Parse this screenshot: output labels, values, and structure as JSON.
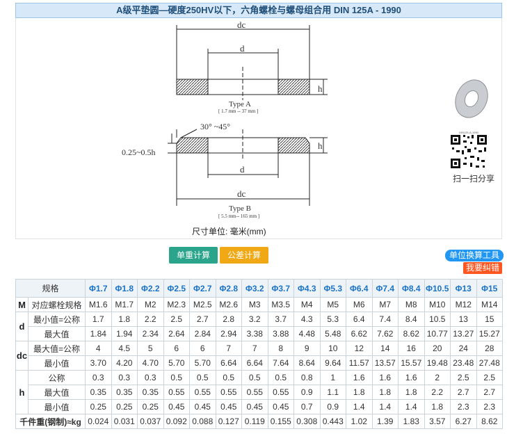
{
  "title": "A级平垫圆—硬度250HV以下，六角螺栓与螺母组合用 DIN 125A - 1990",
  "drawing": {
    "dim_dc": "dc",
    "dim_d": "d",
    "dim_h": "h",
    "type_a": "Type A",
    "type_a_range": "[ 1.7 mm -- 37 mm ]",
    "type_b": "Type B",
    "type_b_range": "[ 5.5 mm-- 165 mm ]",
    "angle": "30° ~45°",
    "chamfer": "0.25~0.5h",
    "unit": "尺寸单位: 毫米(mm)"
  },
  "share": {
    "qr_top": "DIN125-A-1990",
    "caption": "扫一扫分享"
  },
  "buttons": {
    "weight": "单重计算",
    "tolerance": "公差计算",
    "unit_tool": "单位换算工具",
    "report": "我要纠错"
  },
  "table": {
    "spec_label": "规格",
    "sizes": [
      "Φ1.7",
      "Φ1.8",
      "Φ2.2",
      "Φ2.5",
      "Φ2.7",
      "Φ2.8",
      "Φ3.2",
      "Φ3.7",
      "Φ4.3",
      "Φ5.3",
      "Φ6.4",
      "Φ7.4",
      "Φ8.4",
      "Φ10.5",
      "Φ13",
      "Φ15"
    ],
    "rows": [
      {
        "sym": "M",
        "label": "对应螺栓规格",
        "values": [
          "M1.6",
          "M1.7",
          "M2",
          "M2.3",
          "M2.5",
          "M2.6",
          "M3",
          "M3.5",
          "M4",
          "M5",
          "M6",
          "M7",
          "M8",
          "M10",
          "M12",
          "M14"
        ]
      },
      {
        "sym": "d",
        "label": "最小值=公称",
        "values": [
          "1.7",
          "1.8",
          "2.2",
          "2.5",
          "2.7",
          "2.8",
          "3.2",
          "3.7",
          "4.3",
          "5.3",
          "6.4",
          "7.4",
          "8.4",
          "10.5",
          "13",
          "15"
        ]
      },
      {
        "sym": "",
        "label": "最大值",
        "values": [
          "1.84",
          "1.94",
          "2.34",
          "2.64",
          "2.84",
          "2.94",
          "3.38",
          "3.88",
          "4.48",
          "5.48",
          "6.62",
          "7.62",
          "8.62",
          "10.77",
          "13.27",
          "15.27"
        ]
      },
      {
        "sym": "dc",
        "label": "最大值=公称",
        "values": [
          "4",
          "4.5",
          "5",
          "6",
          "6",
          "7",
          "7",
          "8",
          "9",
          "10",
          "12",
          "14",
          "16",
          "20",
          "24",
          "28"
        ]
      },
      {
        "sym": "",
        "label": "最小值",
        "values": [
          "3.70",
          "4.20",
          "4.70",
          "5.70",
          "5.70",
          "6.64",
          "6.64",
          "7.64",
          "8.64",
          "9.64",
          "11.57",
          "13.57",
          "15.57",
          "19.48",
          "23.48",
          "27.48"
        ]
      },
      {
        "sym": "h",
        "label": "公称",
        "values": [
          "0.3",
          "0.3",
          "0.3",
          "0.5",
          "0.5",
          "0.5",
          "0.5",
          "0.5",
          "0.8",
          "1",
          "1.6",
          "1.6",
          "1.6",
          "2",
          "2.5",
          "2.5"
        ]
      },
      {
        "sym": "",
        "label": "最大值",
        "values": [
          "0.35",
          "0.35",
          "0.35",
          "0.55",
          "0.55",
          "0.55",
          "0.55",
          "0.55",
          "0.9",
          "1.1",
          "1.8",
          "1.8",
          "1.8",
          "2.2",
          "2.7",
          "2.7"
        ]
      },
      {
        "sym": "",
        "label": "最小值",
        "values": [
          "0.25",
          "0.25",
          "0.25",
          "0.45",
          "0.45",
          "0.45",
          "0.45",
          "0.45",
          "0.7",
          "0.9",
          "1.4",
          "1.4",
          "1.4",
          "1.8",
          "2.3",
          "2.3"
        ]
      }
    ],
    "weight_label": "千件重(钢制)≈kg",
    "weight_values": [
      "0.024",
      "0.031",
      "0.037",
      "0.092",
      "0.088",
      "0.127",
      "0.119",
      "0.155",
      "0.308",
      "0.443",
      "1.02",
      "1.39",
      "1.83",
      "3.57",
      "6.27",
      "8.62"
    ]
  }
}
